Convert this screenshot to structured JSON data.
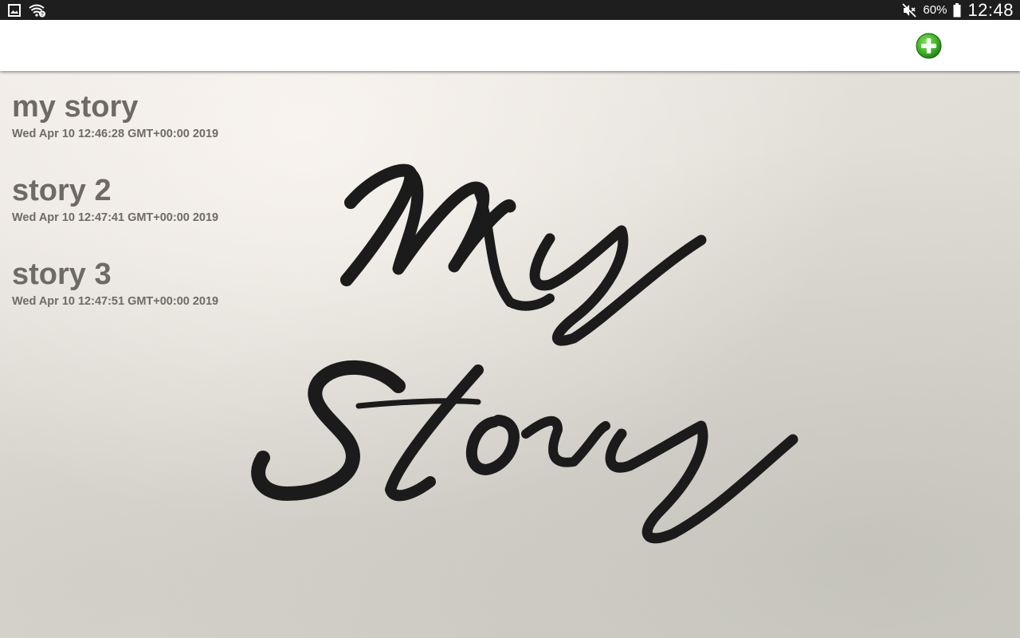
{
  "status_bar": {
    "battery_percent": "60%",
    "clock": "12:48",
    "icons": [
      "gallery-icon",
      "wifi-icon",
      "mute-icon",
      "battery-icon"
    ]
  },
  "app_bar": {
    "add_button_icon": "plus-circle-icon",
    "add_button_color": "#3cb521"
  },
  "background": {
    "artwork_text": "My Story"
  },
  "stories": [
    {
      "title": "my story",
      "date": "Wed Apr 10 12:46:28 GMT+00:00 2019"
    },
    {
      "title": "story 2",
      "date": "Wed Apr 10 12:47:41 GMT+00:00 2019"
    },
    {
      "title": "story 3",
      "date": "Wed Apr 10 12:47:51 GMT+00:00 2019"
    }
  ]
}
